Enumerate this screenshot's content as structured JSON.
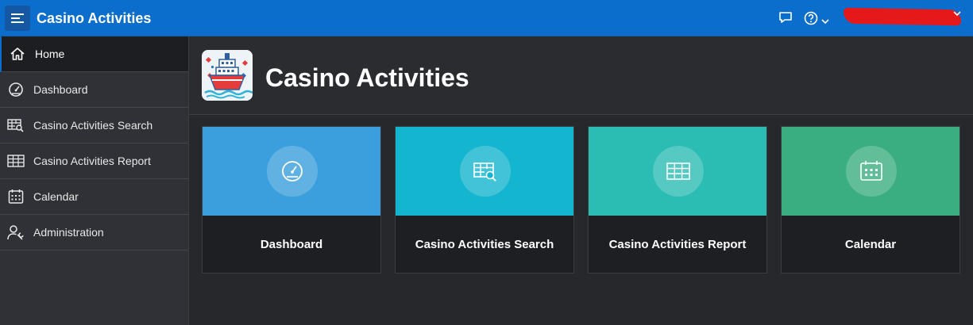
{
  "header": {
    "app_title": "Casino Activities",
    "menu_icon": "hamburger-menu-icon",
    "chat_icon": "chat-bubble-icon",
    "help_icon": "help-question-icon",
    "brand_color": "#0b6dcc"
  },
  "sidebar": {
    "items": [
      {
        "label": "Home",
        "icon": "home-icon",
        "active": true
      },
      {
        "label": "Dashboard",
        "icon": "gauge-icon"
      },
      {
        "label": "Casino Activities Search",
        "icon": "table-search-icon"
      },
      {
        "label": "Casino Activities Report",
        "icon": "table-icon"
      },
      {
        "label": "Calendar",
        "icon": "calendar-icon"
      },
      {
        "label": "Administration",
        "icon": "user-wrench-icon"
      }
    ]
  },
  "hero": {
    "title": "Casino Activities",
    "logo_icon": "cruise-ship-logo"
  },
  "cards": [
    {
      "label": "Dashboard",
      "icon": "gauge-icon",
      "color": "#3a9fdc"
    },
    {
      "label": "Casino Activities Search",
      "icon": "table-search-icon",
      "color": "#13b5cf"
    },
    {
      "label": "Casino Activities Report",
      "icon": "table-icon",
      "color": "#2bbcb3"
    },
    {
      "label": "Calendar",
      "icon": "calendar-icon",
      "color": "#3aae80"
    }
  ]
}
